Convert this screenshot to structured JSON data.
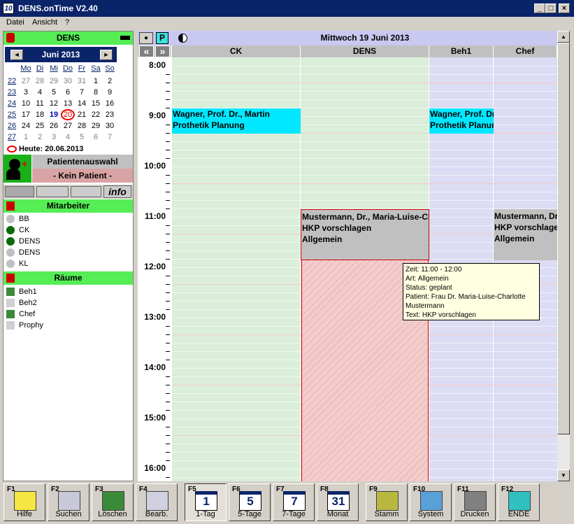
{
  "window": {
    "title": "DENS.onTime  V2.40",
    "icon_text": "10",
    "min": "_",
    "max": "□",
    "close": "×"
  },
  "menu": [
    "Datei",
    "Ansicht",
    "?"
  ],
  "left": {
    "user": "DENS",
    "calendar": {
      "month": "Juni 2013",
      "prev": "◄",
      "next": "►",
      "dow": [
        "Mo",
        "Di",
        "Mi",
        "Do",
        "Fr",
        "Sa",
        "So"
      ],
      "weeks": [
        {
          "wk": "22",
          "days": [
            "27",
            "28",
            "29",
            "30",
            "31",
            "1",
            "2"
          ]
        },
        {
          "wk": "23",
          "days": [
            "3",
            "4",
            "5",
            "6",
            "7",
            "8",
            "9"
          ]
        },
        {
          "wk": "24",
          "days": [
            "10",
            "11",
            "12",
            "13",
            "14",
            "15",
            "16"
          ]
        },
        {
          "wk": "25",
          "days": [
            "17",
            "18",
            "19",
            "20",
            "21",
            "22",
            "23"
          ]
        },
        {
          "wk": "26",
          "days": [
            "24",
            "25",
            "26",
            "27",
            "28",
            "29",
            "30"
          ]
        },
        {
          "wk": "27",
          "days": [
            "1",
            "2",
            "3",
            "4",
            "5",
            "6",
            "7"
          ]
        }
      ],
      "today": "Heute: 20.06.2013"
    },
    "patient_select": "Patientenauswahl",
    "no_patient": "- Kein Patient -",
    "info": "info",
    "staff_header": "Mitarbeiter",
    "staff": [
      {
        "name": "BB",
        "color": "#c0c0c0"
      },
      {
        "name": "CK",
        "color": "#0a6a0a"
      },
      {
        "name": "DENS",
        "color": "#0a6a0a"
      },
      {
        "name": "DENS",
        "color": "#c0c0c0"
      },
      {
        "name": "KL",
        "color": "#c0c0c0"
      }
    ],
    "rooms_header": "Räume",
    "rooms": [
      "Beh1",
      "Beh2",
      "Chef",
      "Prophy"
    ]
  },
  "schedule": {
    "date": "Mittwoch 19 Juni 2013",
    "eye": "👁",
    "p": "P",
    "prev": "«",
    "next": "»",
    "columns": [
      "CK",
      "DENS",
      "Beh1",
      "Chef"
    ],
    "hours": [
      "8:00",
      "9:00",
      "10:00",
      "11:00",
      "12:00",
      "13:00",
      "14:00",
      "15:00",
      "16:00"
    ],
    "appointments": {
      "a1": {
        "l1": "Wagner, Prof. Dr., Martin",
        "l2": "Prothetik Planung"
      },
      "a2": {
        "l1": "Wagner, Prof. Dr., Martin",
        "l2": "Prothetik Planung"
      },
      "a3": {
        "l1": "Mustermann, Dr., Maria-Luise-Charlotte",
        "l2": "HKP vorschlagen",
        "l3": "Allgemein"
      },
      "a4": {
        "l1": "Mustermann, Dr., Maria-Luise-Charlotte",
        "l2": "HKP vorschlagen",
        "l3": "Allgemein"
      }
    },
    "tooltip": [
      "Zeit: 11:00 - 12:00",
      "Art: Allgemein",
      "Status: geplant",
      "Patient: Frau Dr. Maria-Luise-Charlotte",
      "Mustermann",
      "Text: HKP vorschlagen"
    ]
  },
  "toolbar": [
    {
      "key": "F1",
      "label": "Hilfe"
    },
    {
      "key": "F2",
      "label": "Suchen"
    },
    {
      "key": "F3",
      "label": "Löschen"
    },
    {
      "key": "F4",
      "label": "Bearb."
    },
    {
      "key": "F5",
      "label": "1-Tag",
      "num": "1"
    },
    {
      "key": "F6",
      "label": "5-Tage",
      "num": "5"
    },
    {
      "key": "F7",
      "label": "7-Tage",
      "num": "7"
    },
    {
      "key": "F8",
      "label": "Monat",
      "num": "31"
    },
    {
      "key": "F9",
      "label": "Stamm"
    },
    {
      "key": "F10",
      "label": "System"
    },
    {
      "key": "F11",
      "label": "Drucken"
    },
    {
      "key": "F12",
      "label": "ENDE"
    }
  ]
}
